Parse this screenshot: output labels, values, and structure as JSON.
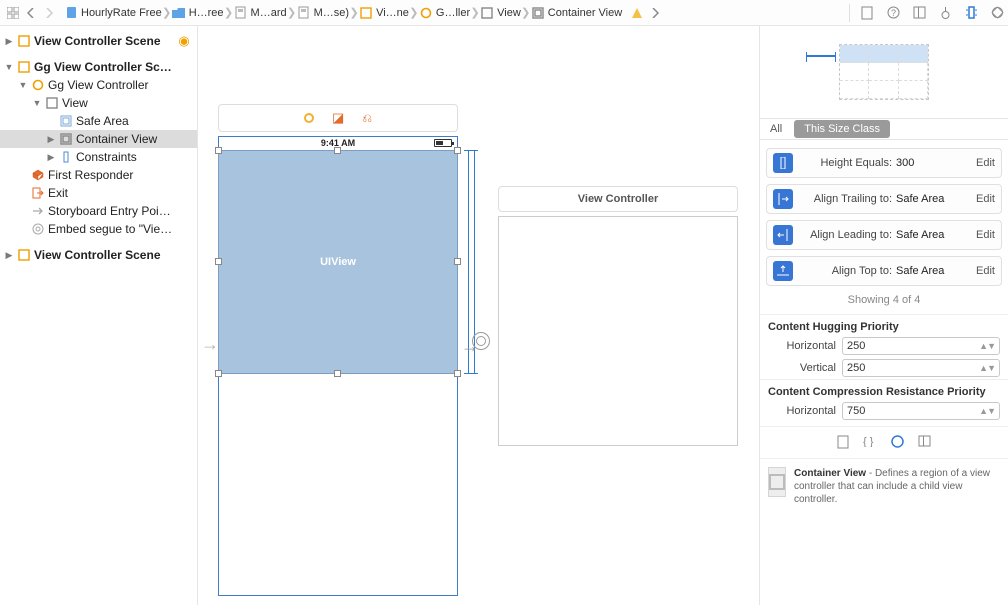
{
  "breadcrumb": {
    "items": [
      {
        "label": "HourlyRate Free"
      },
      {
        "label": "H…ree"
      },
      {
        "label": "M…ard"
      },
      {
        "label": "M…se)"
      },
      {
        "label": "Vi…ne"
      },
      {
        "label": "G…ller"
      },
      {
        "label": "View"
      },
      {
        "label": "Container View"
      }
    ]
  },
  "outline": {
    "items": [
      {
        "label": "View Controller Scene",
        "bold": true,
        "hasDot": true
      },
      {
        "label": "Gg View Controller Sc…",
        "bold": true
      },
      {
        "label": "Gg View Controller"
      },
      {
        "label": "View"
      },
      {
        "label": "Safe Area"
      },
      {
        "label": "Container View"
      },
      {
        "label": "Constraints"
      },
      {
        "label": "First Responder"
      },
      {
        "label": "Exit"
      },
      {
        "label": "Storyboard Entry Poi…"
      },
      {
        "label": "Embed segue to \"Vie…"
      },
      {
        "label": "View Controller Scene",
        "bold": true
      }
    ]
  },
  "canvas": {
    "status_time": "9:41 AM",
    "uiview_label": "UIView",
    "child_title": "View Controller"
  },
  "inspector": {
    "seg_all": "All",
    "seg_size": "This Size Class",
    "constraints": [
      {
        "label": "Height Equals:",
        "value": "300",
        "edit": "Edit"
      },
      {
        "label": "Align Trailing to:",
        "value": "Safe Area",
        "edit": "Edit"
      },
      {
        "label": "Align Leading to:",
        "value": "Safe Area",
        "edit": "Edit"
      },
      {
        "label": "Align Top to:",
        "value": "Safe Area",
        "edit": "Edit"
      }
    ],
    "showing": "Showing 4 of 4",
    "hugging_title": "Content Hugging Priority",
    "hugging_h_label": "Horizontal",
    "hugging_h_value": "250",
    "hugging_v_label": "Vertical",
    "hugging_v_value": "250",
    "compression_title": "Content Compression Resistance Priority",
    "compression_h_label": "Horizontal",
    "compression_h_value": "750",
    "desc_title": "Container View",
    "desc_body": " - Defines a region of a view controller that can include a child view controller."
  }
}
